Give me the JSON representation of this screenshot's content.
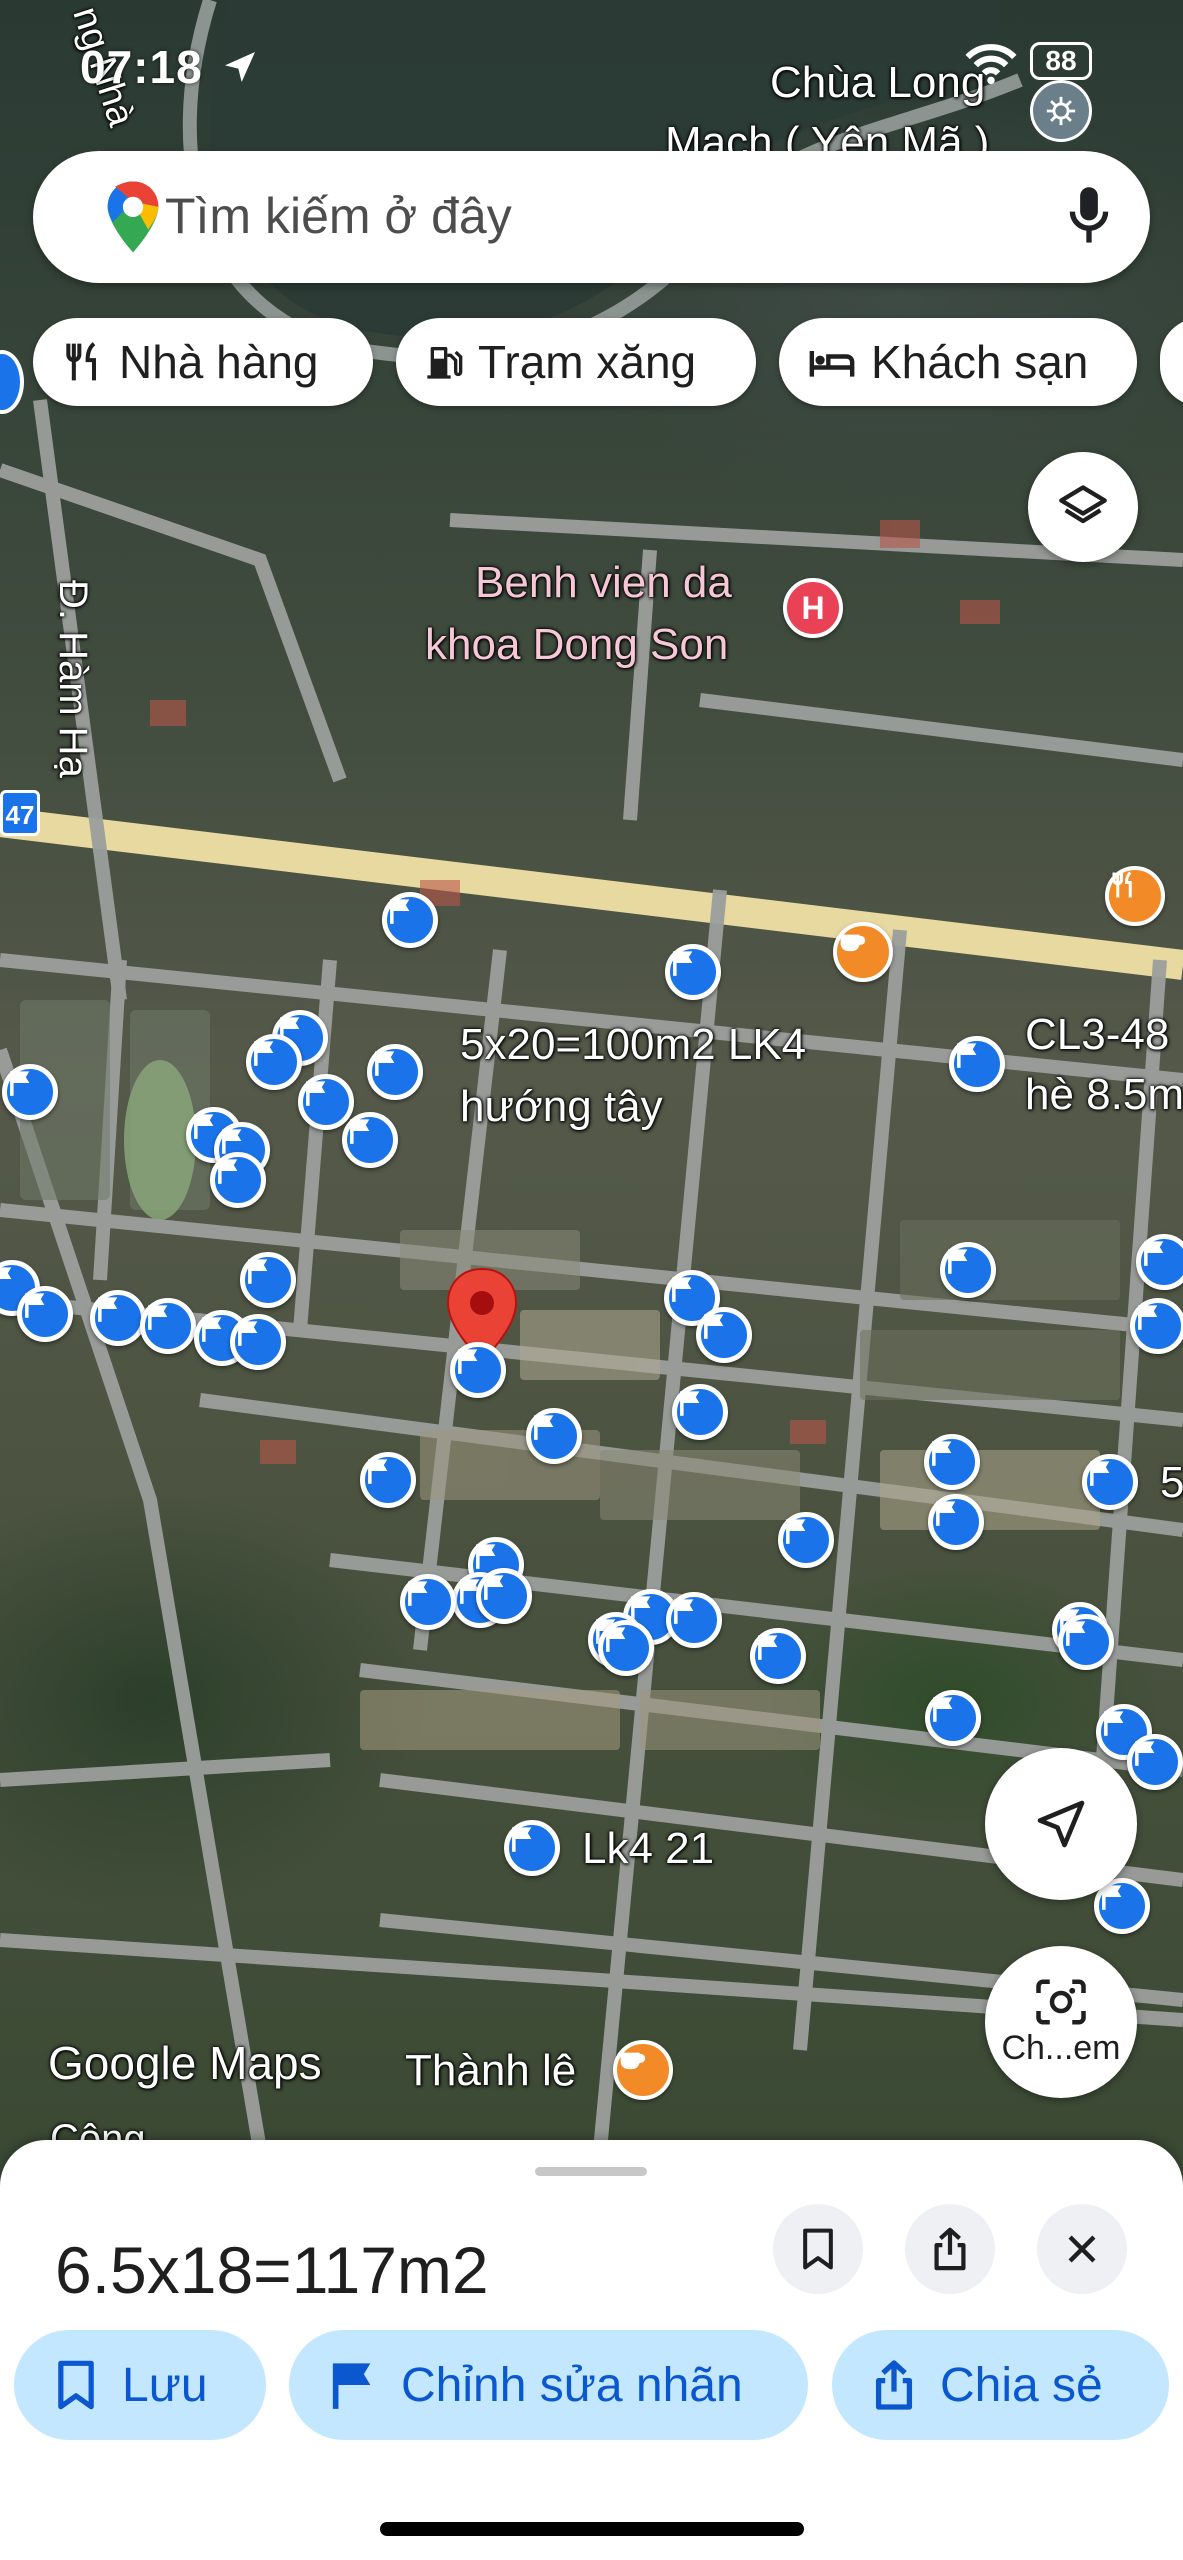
{
  "status_bar": {
    "time": "07:18",
    "battery": "88",
    "icons": [
      "location-arrow-icon",
      "wifi-icon",
      "battery-icon"
    ]
  },
  "search": {
    "placeholder": "Tìm kiếm ở đây",
    "icons": [
      "google-maps-pin-icon",
      "microphone-icon"
    ]
  },
  "chips": [
    {
      "label": "Nhà hàng",
      "icon": "restaurant-icon"
    },
    {
      "label": "Trạm xăng",
      "icon": "gas-station-icon"
    },
    {
      "label": "Khách sạn",
      "icon": "hotel-bed-icon"
    }
  ],
  "map": {
    "labels": {
      "temple_line1": "Chùa Long",
      "temple_line2": "Mạch ( Yên Mã )",
      "road": "Đ. Hàm Hạ",
      "road_partial": "ng Nhà",
      "road_number": "47",
      "hospital_line1": "Benh vien da",
      "hospital_line2": "khoa Dong Son",
      "lot1_line1": "5x20=100m2 LK4",
      "lot1_line2": "hướng tây",
      "lot2_line1": "CL3-48",
      "lot2_line2": "hè 8.5m",
      "lot3": "Lk4 21",
      "cafe": "Thành lê",
      "bottom_partial": "Công ...",
      "edge_5": "5",
      "google_logo": "Google Maps"
    },
    "colors": {
      "pin_blue": "#1a73e8",
      "selected_red": "#ea4335",
      "hospital": "#e94257",
      "cafe_orange": "#f28b27",
      "road_main": "#e8d9a0"
    }
  },
  "controls": {
    "layers": "layers-icon",
    "locate": "navigation-arrow-icon",
    "lens_label": "Ch...em"
  },
  "sheet": {
    "title": "6.5x18=117m2",
    "actions": [
      {
        "label": "Lưu",
        "icon": "bookmark-icon"
      },
      {
        "label": "Chỉnh sửa nhãn",
        "icon": "flag-icon"
      },
      {
        "label": "Chia sẻ",
        "icon": "share-icon"
      }
    ],
    "icon_buttons": [
      "bookmark-icon",
      "share-icon",
      "close-icon"
    ]
  }
}
